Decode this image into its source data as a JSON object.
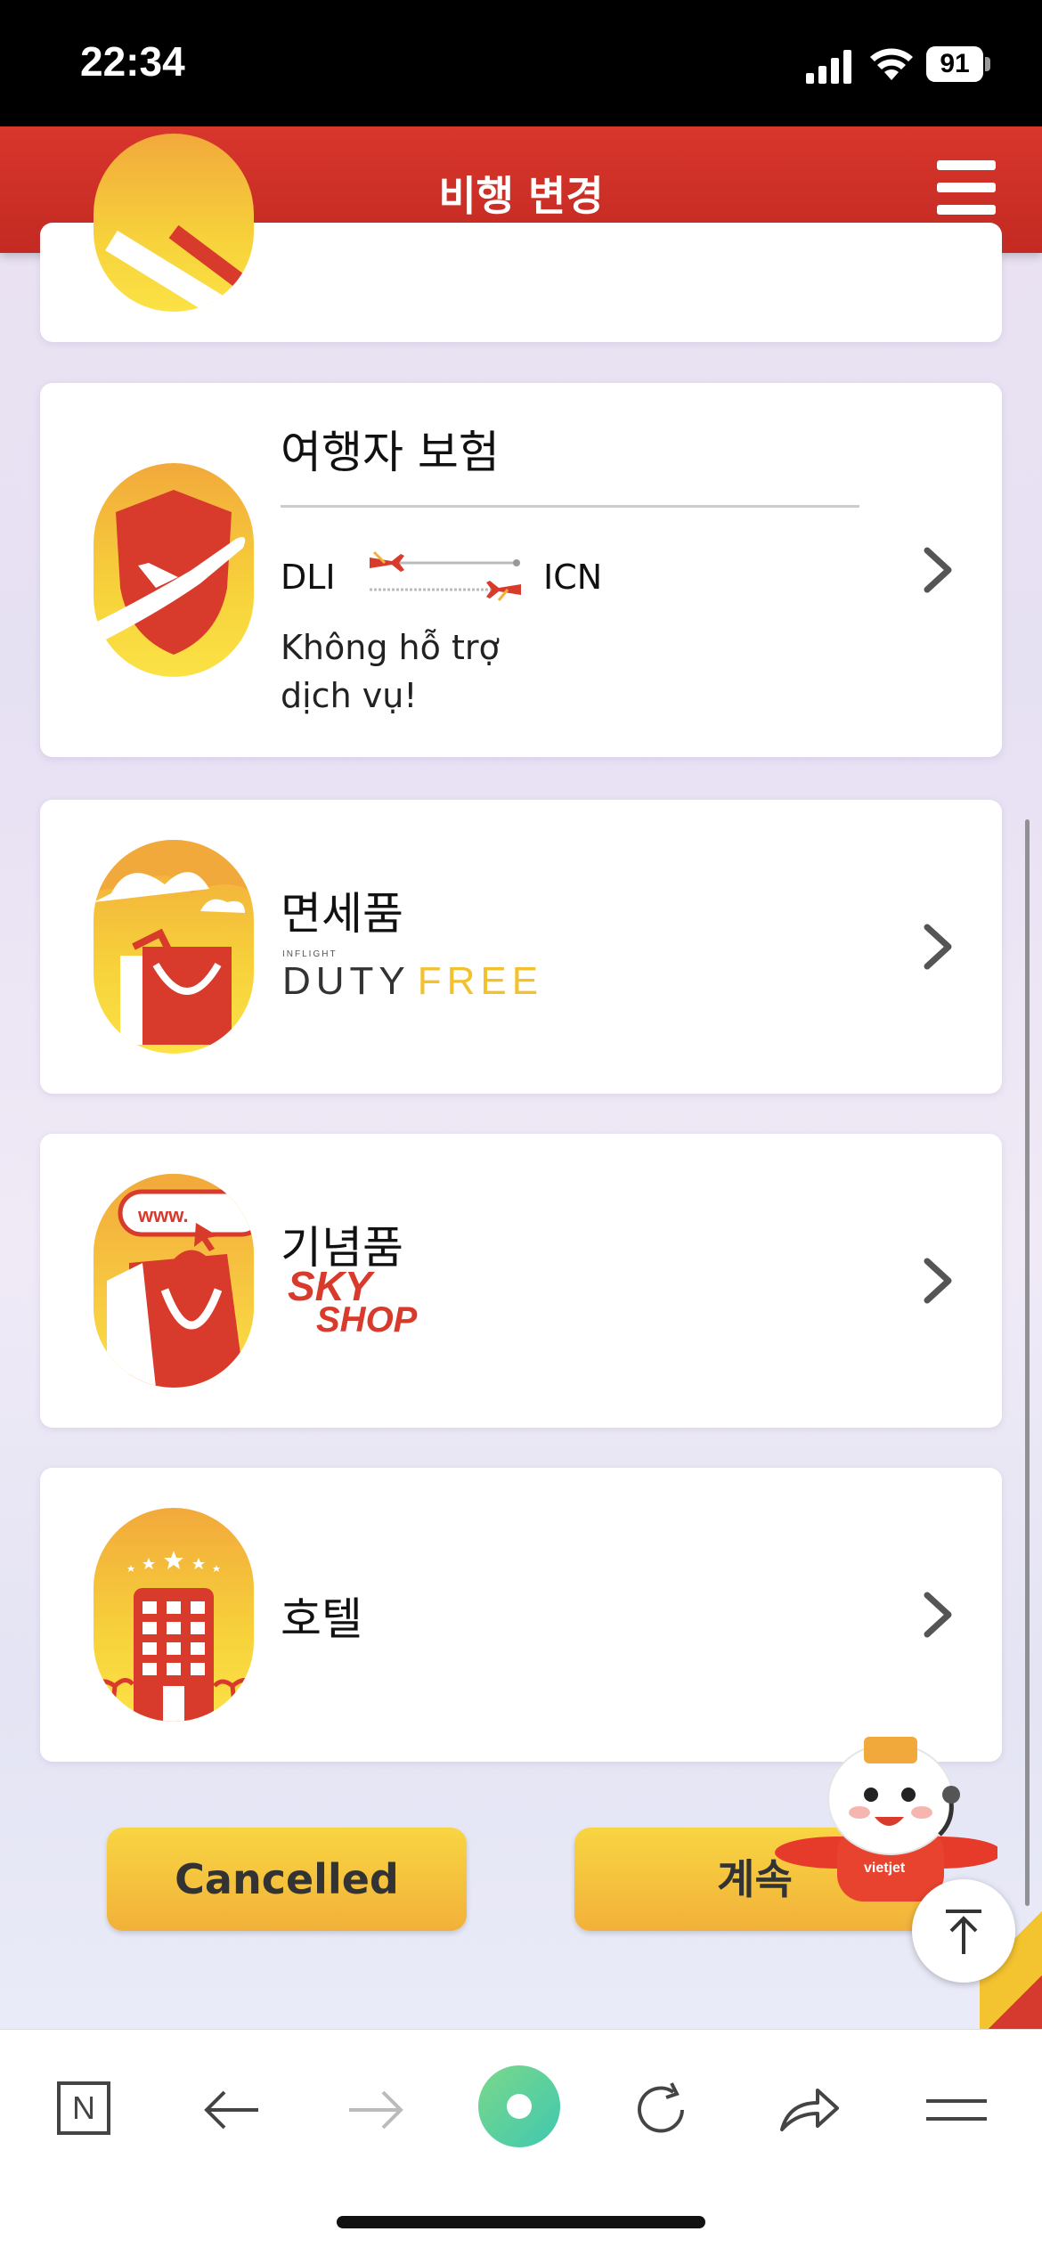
{
  "status_bar": {
    "time": "22:34",
    "battery": "91"
  },
  "header": {
    "title": "비행 변경"
  },
  "cards": {
    "insurance": {
      "title": "여행자 보험",
      "origin": "DLI",
      "destination": "ICN",
      "status_line1": "Không hỗ trợ",
      "status_line2": "dịch vụ!"
    },
    "duty_free": {
      "title": "면세품",
      "logo_small": "INFLIGHT",
      "logo_left": "DUTY",
      "logo_right": "FREE"
    },
    "souvenir": {
      "title": "기념품",
      "logo_top": "SKY",
      "logo_bottom": "SHOP",
      "web_label": "www."
    },
    "hotel": {
      "title": "호텔"
    }
  },
  "buttons": {
    "cancel": "Cancelled",
    "continue": "계속"
  },
  "mascot": {
    "shirt_text": "vietjet"
  },
  "toolbar": {
    "tab_label": "N"
  },
  "colors": {
    "brand_red": "#d8362c",
    "brand_yellow": "#f7d23b"
  }
}
